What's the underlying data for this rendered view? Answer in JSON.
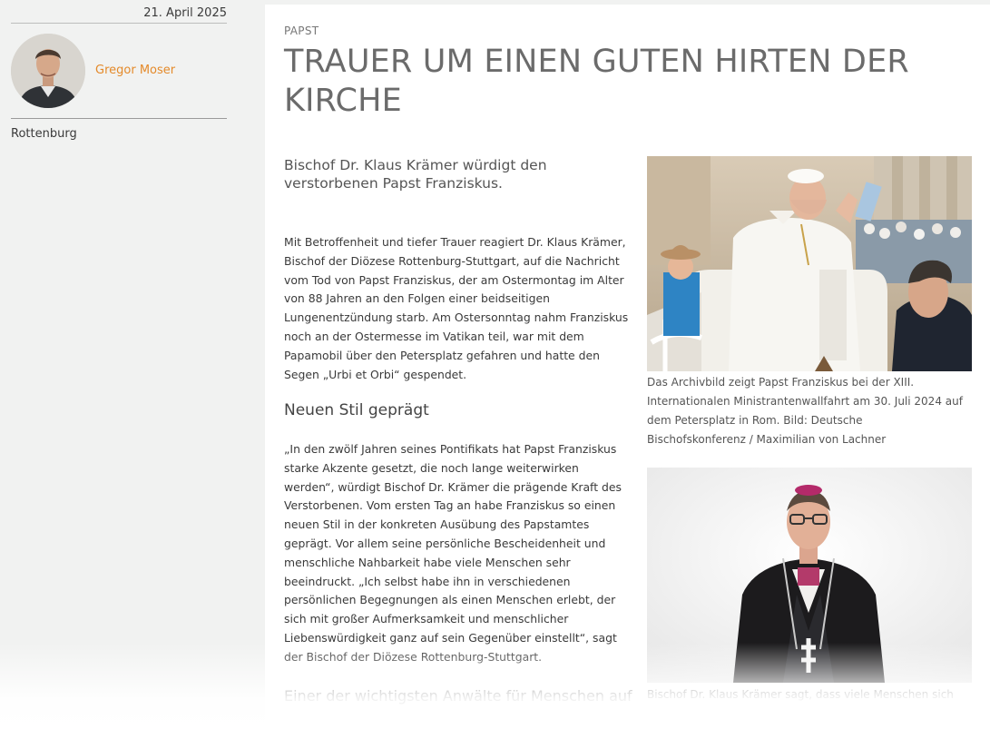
{
  "sidebar": {
    "date": "21. April 2025",
    "author": "Gregor Moser",
    "location": "Rottenburg"
  },
  "article": {
    "kicker": "PAPST",
    "title": "TRAUER UM EINEN GUTEN HIRTEN DER KIRCHE",
    "lead": "Bischof Dr. Klaus Krämer würdigt den verstorbenen Papst Franziskus.",
    "paragraph1": "Mit Betroffenheit und tiefer Trauer reagiert Dr. Klaus Krämer, Bischof der Diözese Rottenburg-Stuttgart, auf die Nachricht vom Tod von Papst Franziskus, der am Ostermontag im Alter von 88 Jahren an den Folgen einer beidseitigen Lungenentzündung starb. Am Ostersonntag nahm Franziskus noch an der Ostermesse im Vatikan teil, war mit dem Papamobil über den Petersplatz gefahren und hatte den Segen „Urbi et Orbi“ gespendet.",
    "heading2": "Neuen Stil geprägt",
    "paragraph2": "„In den zwölf Jahren seines Pontifikats hat Papst Franziskus starke Akzente gesetzt, die noch lange weiterwirken werden“, würdigt Bischof Dr. Krämer die prägende Kraft des Verstorbenen. Vom ersten Tag an habe Franziskus so einen neuen Stil in der konkreten Ausübung des Papstamtes geprägt. Vor allem seine persönliche Bescheidenheit und menschliche Nahbarkeit habe viele Menschen sehr beeindruckt. „Ich selbst habe ihn in verschiedenen persönlichen Begegnungen als einen Menschen erlebt, der sich mit großer Aufmerksamkeit und menschlicher Liebenswürdigkeit ganz auf sein Gegenüber einstellt“, sagt der Bischof der Diözese Rottenburg-Stuttgart.",
    "heading3": "Einer der wichtigsten Anwälte für Menschen auf",
    "caption1": "Das Archivbild zeigt Papst Franziskus bei der XIII. Internationalen Ministrantenwallfahrt am 30. Juli 2024 auf dem Petersplatz in Rom. Bild: Deutsche Bischofskonferenz / Maximilian von Lachner",
    "caption2": "Bischof Dr. Klaus Krämer sagt, dass viele Menschen sich"
  }
}
